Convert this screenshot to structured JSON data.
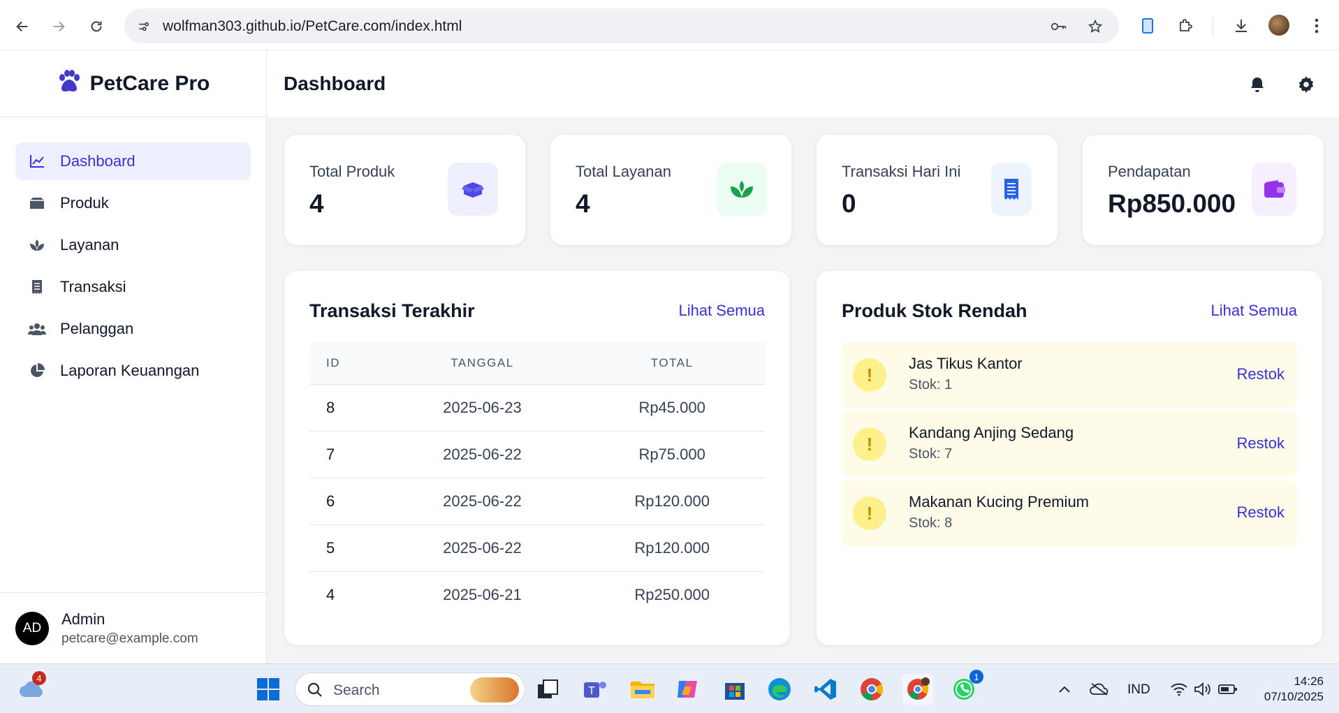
{
  "browser": {
    "url": "wolfman303.github.io/PetCare.com/index.html"
  },
  "app": {
    "brand": "PetCare Pro",
    "page_title": "Dashboard"
  },
  "sidebar": {
    "items": [
      {
        "label": "Dashboard",
        "icon": "chart-line-icon"
      },
      {
        "label": "Produk",
        "icon": "box-icon"
      },
      {
        "label": "Layanan",
        "icon": "spa-icon"
      },
      {
        "label": "Transaksi",
        "icon": "receipt-icon"
      },
      {
        "label": "Pelanggan",
        "icon": "users-icon"
      },
      {
        "label": "Laporan Keuanngan",
        "icon": "pie-chart-icon"
      }
    ],
    "user": {
      "initials": "AD",
      "name": "Admin",
      "email": "petcare@example.com"
    }
  },
  "stats": [
    {
      "label": "Total Produk",
      "value": "4",
      "color": "#4f46e5"
    },
    {
      "label": "Total Layanan",
      "value": "4",
      "color": "#16a34a"
    },
    {
      "label": "Transaksi Hari Ini",
      "value": "0",
      "color": "#2563eb"
    },
    {
      "label": "Pendapatan",
      "value": "Rp850.000",
      "color": "#9333ea"
    }
  ],
  "transactions": {
    "title": "Transaksi Terakhir",
    "link": "Lihat Semua",
    "columns": [
      "ID",
      "TANGGAL",
      "TOTAL"
    ],
    "rows": [
      {
        "id": "8",
        "date": "2025-06-23",
        "total": "Rp45.000"
      },
      {
        "id": "7",
        "date": "2025-06-22",
        "total": "Rp75.000"
      },
      {
        "id": "6",
        "date": "2025-06-22",
        "total": "Rp120.000"
      },
      {
        "id": "5",
        "date": "2025-06-22",
        "total": "Rp120.000"
      },
      {
        "id": "4",
        "date": "2025-06-21",
        "total": "Rp250.000"
      }
    ]
  },
  "low_stock": {
    "title": "Produk Stok Rendah",
    "link": "Lihat Semua",
    "items": [
      {
        "mark": "!",
        "name": "Jas Tikus Kantor",
        "stock": "Stok: 1",
        "action": "Restok"
      },
      {
        "mark": "!",
        "name": "Kandang Anjing Sedang",
        "stock": "Stok: 7",
        "action": "Restok"
      },
      {
        "mark": "!",
        "name": "Makanan Kucing Premium",
        "stock": "Stok: 8",
        "action": "Restok"
      }
    ]
  },
  "taskbar": {
    "search_placeholder": "Search",
    "weather_badge": "4",
    "whatsapp_badge": "1",
    "language": "IND",
    "time": "14:26",
    "date": "07/10/2025"
  }
}
